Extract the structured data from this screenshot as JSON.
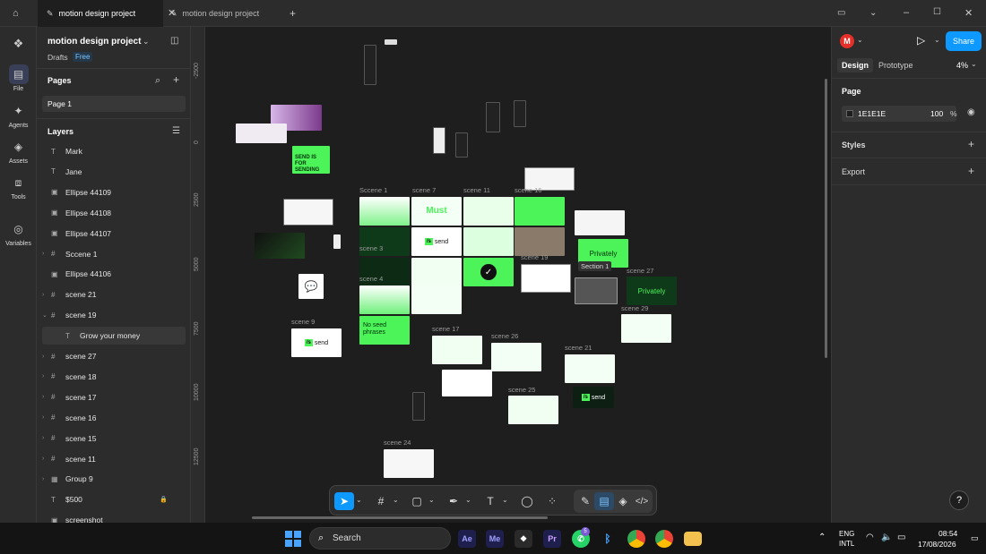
{
  "tabs": [
    {
      "title": "motion design project",
      "active": true
    },
    {
      "title": "motion design project",
      "active": false
    }
  ],
  "rail": [
    {
      "label": "File",
      "icon": "file-icon",
      "glyph": "▤"
    },
    {
      "label": "Agents",
      "icon": "sparkle-icon",
      "glyph": "✦"
    },
    {
      "label": "Assets",
      "icon": "assets-icon",
      "glyph": "◈"
    },
    {
      "label": "Tools",
      "icon": "toolbox-icon",
      "glyph": "⧈"
    },
    {
      "label": "Variables",
      "icon": "variables-icon",
      "glyph": "◎"
    }
  ],
  "project": {
    "name": "motion design project",
    "team": "Drafts",
    "plan": "Free"
  },
  "pages": {
    "title": "Pages",
    "items": [
      "Page 1"
    ]
  },
  "layers": {
    "title": "Layers",
    "items": [
      {
        "name": "Mark",
        "kind": "T",
        "expand": ""
      },
      {
        "name": "Jane",
        "kind": "T",
        "expand": ""
      },
      {
        "name": "Ellipse 44109",
        "kind": "▣",
        "expand": ""
      },
      {
        "name": "Ellipse 44108",
        "kind": "▣",
        "expand": ""
      },
      {
        "name": "Ellipse 44107",
        "kind": "▣",
        "expand": ""
      },
      {
        "name": "Sccene 1",
        "kind": "#",
        "expand": "›"
      },
      {
        "name": "Ellipse 44106",
        "kind": "▣",
        "expand": ""
      },
      {
        "name": "scene 21",
        "kind": "#",
        "expand": "›"
      },
      {
        "name": "scene 19",
        "kind": "#",
        "expand": "⌄"
      },
      {
        "name": "Grow your money",
        "kind": "T",
        "expand": "",
        "child": true
      },
      {
        "name": "scene 27",
        "kind": "#",
        "expand": "›"
      },
      {
        "name": "scene 18",
        "kind": "#",
        "expand": "›"
      },
      {
        "name": "scene 17",
        "kind": "#",
        "expand": "›"
      },
      {
        "name": "scene 16",
        "kind": "#",
        "expand": "›"
      },
      {
        "name": "scene 15",
        "kind": "#",
        "expand": "›"
      },
      {
        "name": "scene 11",
        "kind": "#",
        "expand": "›"
      },
      {
        "name": "Group 9",
        "kind": "▦",
        "expand": "›"
      },
      {
        "name": "$500",
        "kind": "T",
        "expand": "",
        "locked": true
      },
      {
        "name": "screenshot",
        "kind": "▣",
        "expand": ""
      }
    ]
  },
  "ruler": {
    "x": [
      "-32500",
      "-30000",
      "-27500",
      "-25000",
      "-22500",
      "-20000",
      "-17500",
      "-15000",
      "-12500",
      "-10000"
    ],
    "y": [
      "-2500",
      "0",
      "2500",
      "5000",
      "7500",
      "10000",
      "12500"
    ]
  },
  "canvas": {
    "labels": [
      "Sccene 1",
      "scene 7",
      "scene 11",
      "scene 16",
      "scene 3",
      "scene 19",
      "Section 1",
      "scene 27",
      "scene 4",
      "scene 29",
      "scene 9",
      "scene 17",
      "scene 26",
      "scene 21",
      "scene 25",
      "scene 24"
    ],
    "texts": {
      "send_for_sending": "SEND IS FOR SENDING",
      "privately": "Privately",
      "no_seed": "No seed phrases",
      "send": "send",
      "js": "/s"
    }
  },
  "right": {
    "avatar": "M",
    "share": "Share",
    "tab_design": "Design",
    "tab_prototype": "Prototype",
    "zoom": "4%",
    "page_section": "Page",
    "bg_hex": "1E1E1E",
    "opacity": "100",
    "percent": "%",
    "styles": "Styles",
    "export": "Export"
  },
  "taskbar": {
    "search": "Search",
    "lang1": "ENG",
    "lang2": "INTL",
    "time": "08:54",
    "date": "17/08/2026",
    "badge": "5"
  },
  "colors": {
    "accent": "#0d99ff",
    "brand_green": "#4cf45a",
    "canvas_bg": "#1e1e1e"
  }
}
